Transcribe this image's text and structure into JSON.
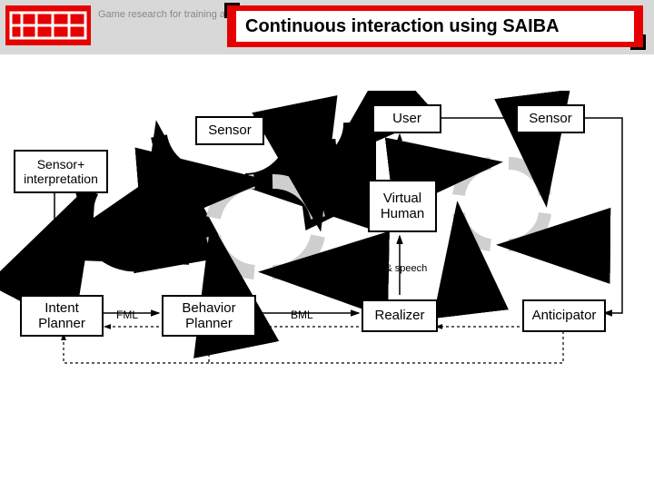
{
  "header": {
    "logo_subtitle": "Game research\nfor training and\nentertainment",
    "title": "Continuous interaction using SAIBA"
  },
  "boxes": {
    "user": "User",
    "sensor_top_right": "Sensor",
    "sensor_top_mid": "Sensor",
    "sensor_interp": "Sensor+\ninterpretation",
    "virtual_human": "Virtual\nHuman",
    "intent_planner": "Intent\nPlanner",
    "behavior_planner": "Behavior\nPlanner",
    "realizer": "Realizer",
    "anticipator": "Anticipator"
  },
  "labels": {
    "fml": "FML",
    "bml": "BML",
    "movement_speech": "movement & speech"
  }
}
